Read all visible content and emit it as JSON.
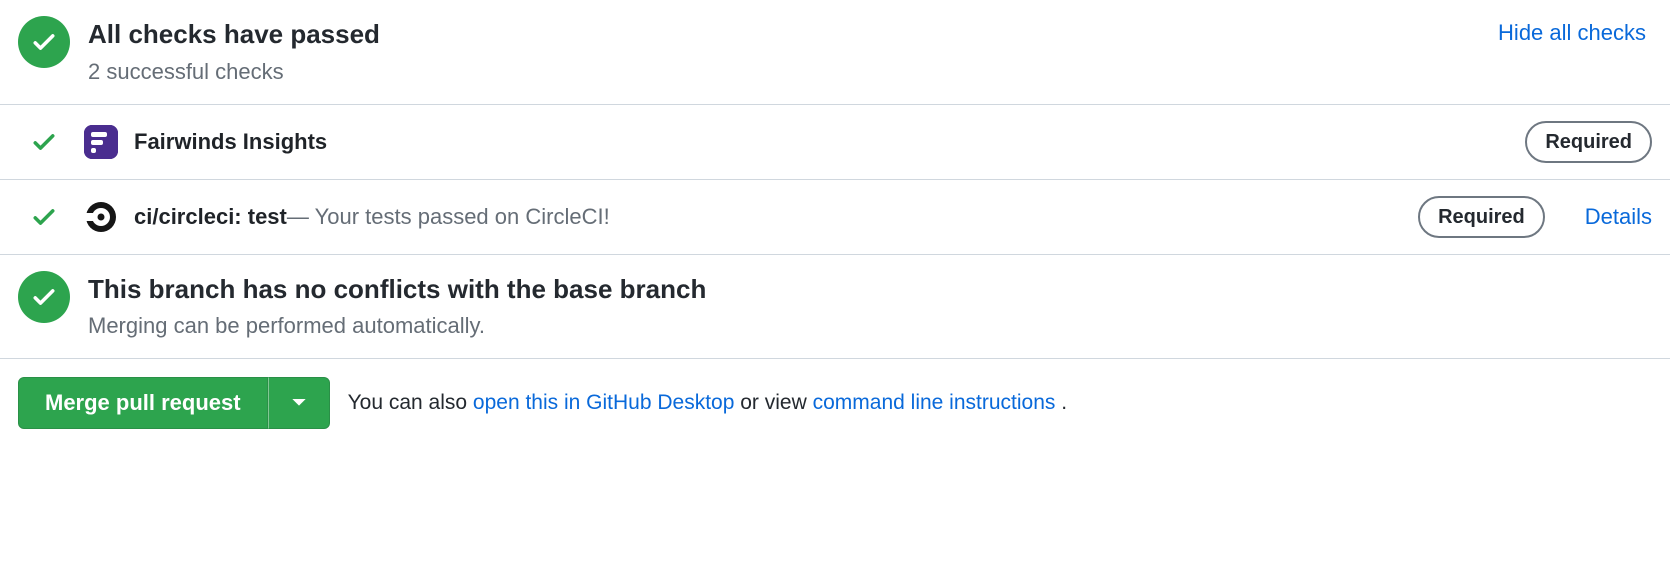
{
  "checksSummary": {
    "title": "All checks have passed",
    "subtitle": "2 successful checks",
    "toggleLabel": "Hide all checks"
  },
  "checks": [
    {
      "name": "Fairwinds Insights",
      "description": "",
      "required": "Required",
      "detailsLabel": ""
    },
    {
      "name": "ci/circleci: test",
      "description": " — Your tests passed on CircleCI!",
      "required": "Required",
      "detailsLabel": "Details"
    }
  ],
  "conflicts": {
    "title": "This branch has no conflicts with the base branch",
    "subtitle": "Merging can be performed automatically."
  },
  "merge": {
    "buttonLabel": "Merge pull request",
    "helpPrefix": "You can also ",
    "desktopLink": "open this in GitHub Desktop",
    "helpMiddle": " or view ",
    "cliLink": "command line instructions",
    "helpSuffix": "."
  }
}
